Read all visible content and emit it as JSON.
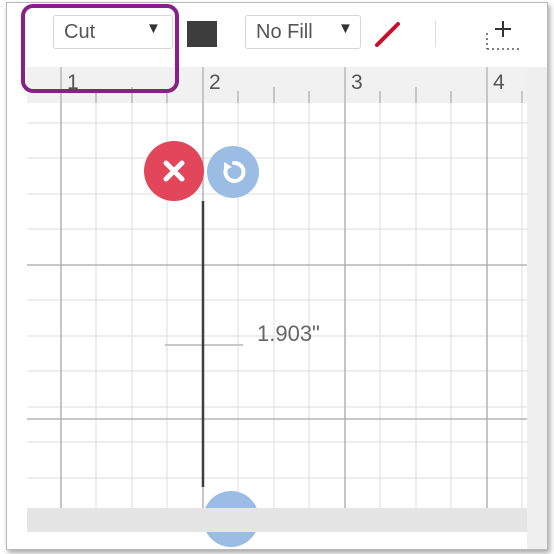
{
  "toolbar": {
    "operation_dropdown": {
      "value": "Cut"
    },
    "fill_dropdown": {
      "value": "No Fill"
    }
  },
  "ruler": {
    "marks": [
      "1",
      "2",
      "3",
      "4"
    ]
  },
  "canvas": {
    "dimension_label": "1.903\""
  },
  "icons": {
    "dropdown_arrow": "caret-down-icon",
    "delete": "close-icon",
    "rotate": "rotate-icon",
    "pen": "pen-slash-icon",
    "align": "align-icon"
  },
  "colors": {
    "highlight": "#8a1f8a",
    "delete_button": "#e2465a",
    "rotate_button": "#9bbde4",
    "pen_color": "#c8102e",
    "line_color": "#3d3d3d"
  }
}
